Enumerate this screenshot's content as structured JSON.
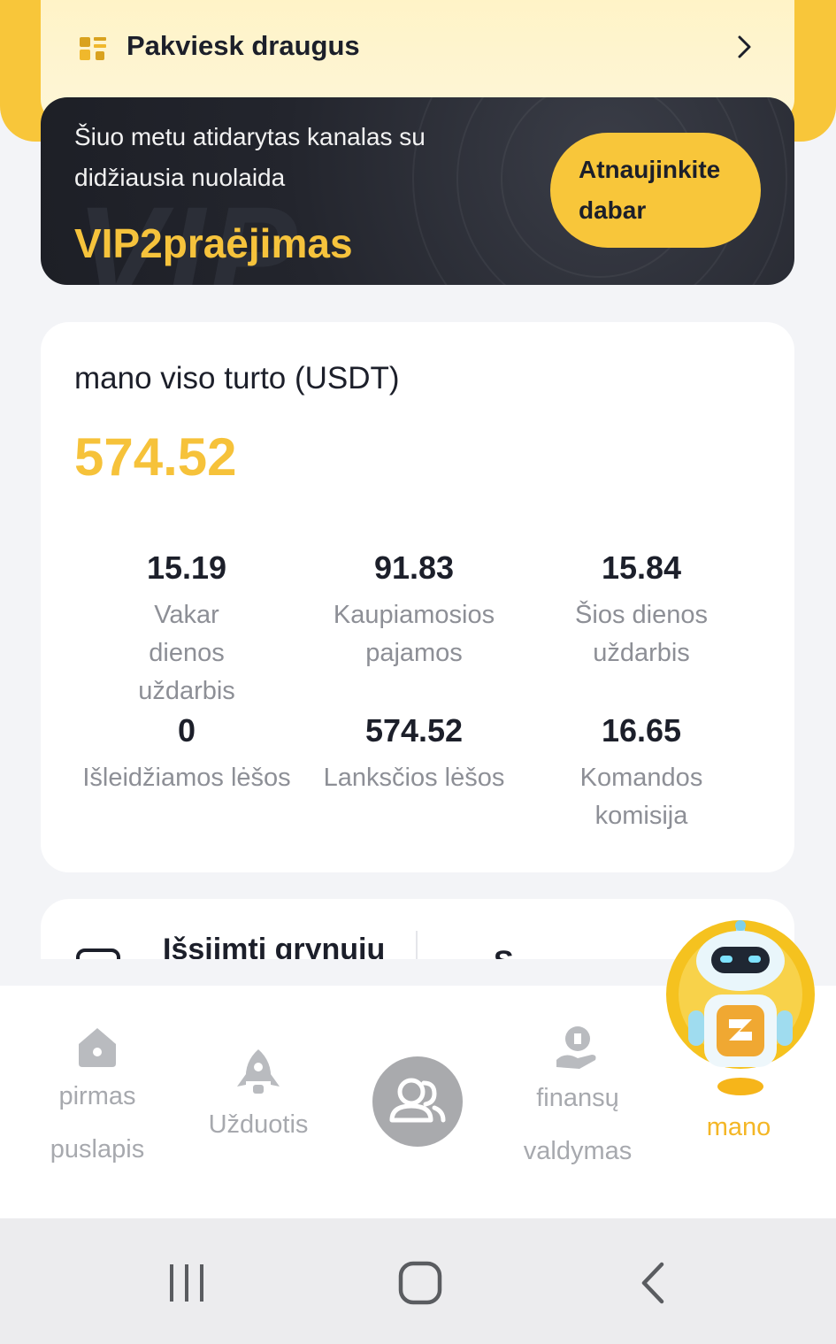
{
  "invite": {
    "label": "Pakviesk draugus",
    "icon": "users-icon",
    "chevron_icon": "chevron-right-icon"
  },
  "vip_banner": {
    "description": "Šiuo metu atidarytas kanalas su didžiausia nuolaida",
    "title": "VIP2praėjimas",
    "watermark": "VIP",
    "upgrade_button": "Atnaujinkite dabar"
  },
  "assets": {
    "title": "mano viso turto (USDT)",
    "total": "574.52",
    "stats": [
      {
        "value": "15.19",
        "label": "Vakar dienos uždarbis"
      },
      {
        "value": "91.83",
        "label": "Kaupiamosios pajamos"
      },
      {
        "value": "15.84",
        "label": "Šios dienos uždarbis"
      },
      {
        "value": "0",
        "label": "Išleidžiamos lėšos"
      },
      {
        "value": "574.52",
        "label": "Lanksčios lėšos"
      },
      {
        "value": "16.65",
        "label": "Komandos komisija"
      }
    ]
  },
  "next_card": {
    "withdraw_label": "Išsiimti grynuių",
    "second_label": "S..."
  },
  "bottom_nav": {
    "items": [
      {
        "label": "pirmas puslapis",
        "icon": "home-icon"
      },
      {
        "label": "Užduotis",
        "icon": "rocket-icon"
      },
      {
        "label": "",
        "icon": "team-icon"
      },
      {
        "label": "finansų valdymas",
        "icon": "finance-icon"
      },
      {
        "label": "mano",
        "icon": "robot-avatar-icon"
      }
    ],
    "active_index": 4
  },
  "system_nav": {
    "icons": [
      "recent-apps-icon",
      "home-button-icon",
      "back-icon"
    ]
  },
  "colors": {
    "accent": "#f8c63a",
    "accent_text": "#f6c23a",
    "dark_banner": "#23252d",
    "muted_text": "#8d8f96"
  }
}
